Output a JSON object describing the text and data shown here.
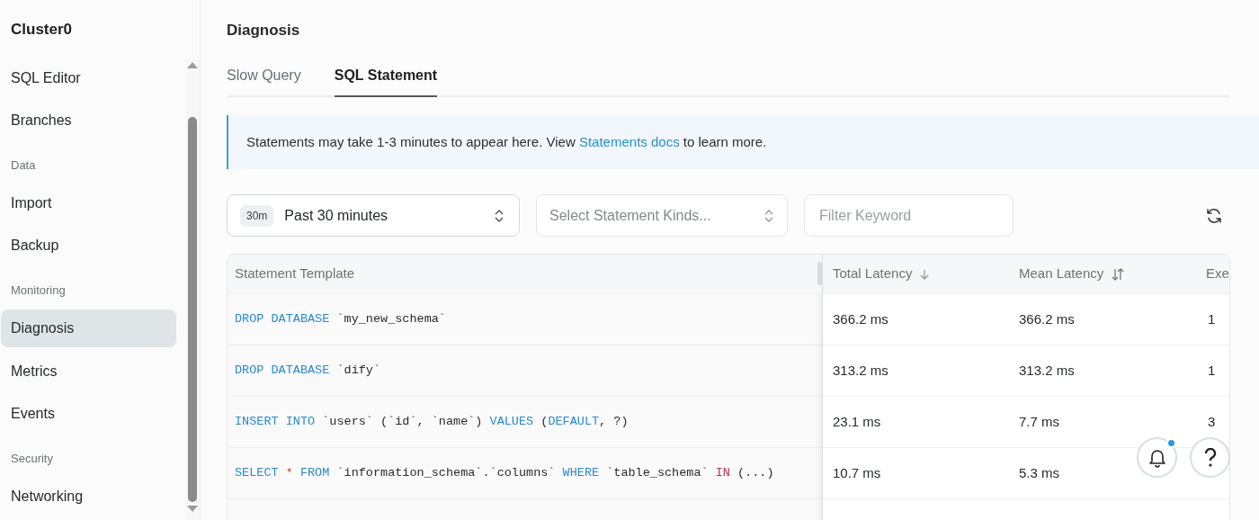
{
  "sidebar": {
    "title": "Cluster0",
    "items": [
      {
        "kind": "link",
        "label": "SQL Editor",
        "selected": false
      },
      {
        "kind": "link",
        "label": "Branches",
        "selected": false
      },
      {
        "kind": "section",
        "label": "Data"
      },
      {
        "kind": "link",
        "label": "Import",
        "selected": false
      },
      {
        "kind": "link",
        "label": "Backup",
        "selected": false
      },
      {
        "kind": "section",
        "label": "Monitoring"
      },
      {
        "kind": "link",
        "label": "Diagnosis",
        "selected": true
      },
      {
        "kind": "link",
        "label": "Metrics",
        "selected": false
      },
      {
        "kind": "link",
        "label": "Events",
        "selected": false
      },
      {
        "kind": "section",
        "label": "Security"
      },
      {
        "kind": "link",
        "label": "Networking",
        "selected": false
      }
    ]
  },
  "page": {
    "title": "Diagnosis",
    "tabs": [
      {
        "label": "Slow Query",
        "selected": false
      },
      {
        "label": "SQL Statement",
        "selected": true
      }
    ],
    "notice": {
      "before": "Statements may take 1-3 minutes to appear here. View ",
      "link": "Statements docs",
      "after": " to learn more."
    },
    "time_range": {
      "badge": "30m",
      "value": "Past 30 minutes"
    },
    "statement_kinds": {
      "placeholder": "Select Statement Kinds..."
    },
    "filter": {
      "placeholder": "Filter Keyword"
    },
    "table": {
      "columns": [
        {
          "label": "Statement Template"
        },
        {
          "label": "Total Latency",
          "sorted": true
        },
        {
          "label": "Mean Latency",
          "sorted": false
        },
        {
          "label": "Exe"
        }
      ],
      "rows": [
        {
          "statement": [
            {
              "kind": "keyword",
              "text": "DROP DATABASE"
            },
            {
              "kind": "ident",
              "text": " `my_new_schema`"
            }
          ],
          "total": "366.2 ms",
          "mean": "366.2 ms",
          "column_4": "1"
        },
        {
          "statement": [
            {
              "kind": "keyword",
              "text": "DROP DATABASE"
            },
            {
              "kind": "ident",
              "text": " `dify`"
            }
          ],
          "total": "313.2 ms",
          "mean": "313.2 ms",
          "column_4": "1"
        },
        {
          "statement": [
            {
              "kind": "keyword",
              "text": "INSERT INTO"
            },
            {
              "kind": "ident",
              "text": " `users` (`id`, `name`) "
            },
            {
              "kind": "keyword",
              "text": "VALUES"
            },
            {
              "kind": "ident",
              "text": " ("
            },
            {
              "kind": "keyword",
              "text": "DEFAULT"
            },
            {
              "kind": "ident",
              "text": ", ?)"
            }
          ],
          "total": "23.1 ms",
          "mean": "7.7 ms",
          "column_4": "3"
        },
        {
          "statement": [
            {
              "kind": "keyword",
              "text": "SELECT"
            },
            {
              "kind": "operator",
              "text": " * "
            },
            {
              "kind": "keyword",
              "text": "FROM"
            },
            {
              "kind": "ident",
              "text": " `information_schema`.`columns` "
            },
            {
              "kind": "keyword",
              "text": "WHERE"
            },
            {
              "kind": "ident",
              "text": " `table_schema` "
            },
            {
              "kind": "operator",
              "text": "IN"
            },
            {
              "kind": "ident",
              "text": " (...)"
            }
          ],
          "total": "10.7 ms",
          "mean": "5.3 ms",
          "column_4": ""
        }
      ]
    }
  },
  "notifications": {
    "unread": true
  }
}
